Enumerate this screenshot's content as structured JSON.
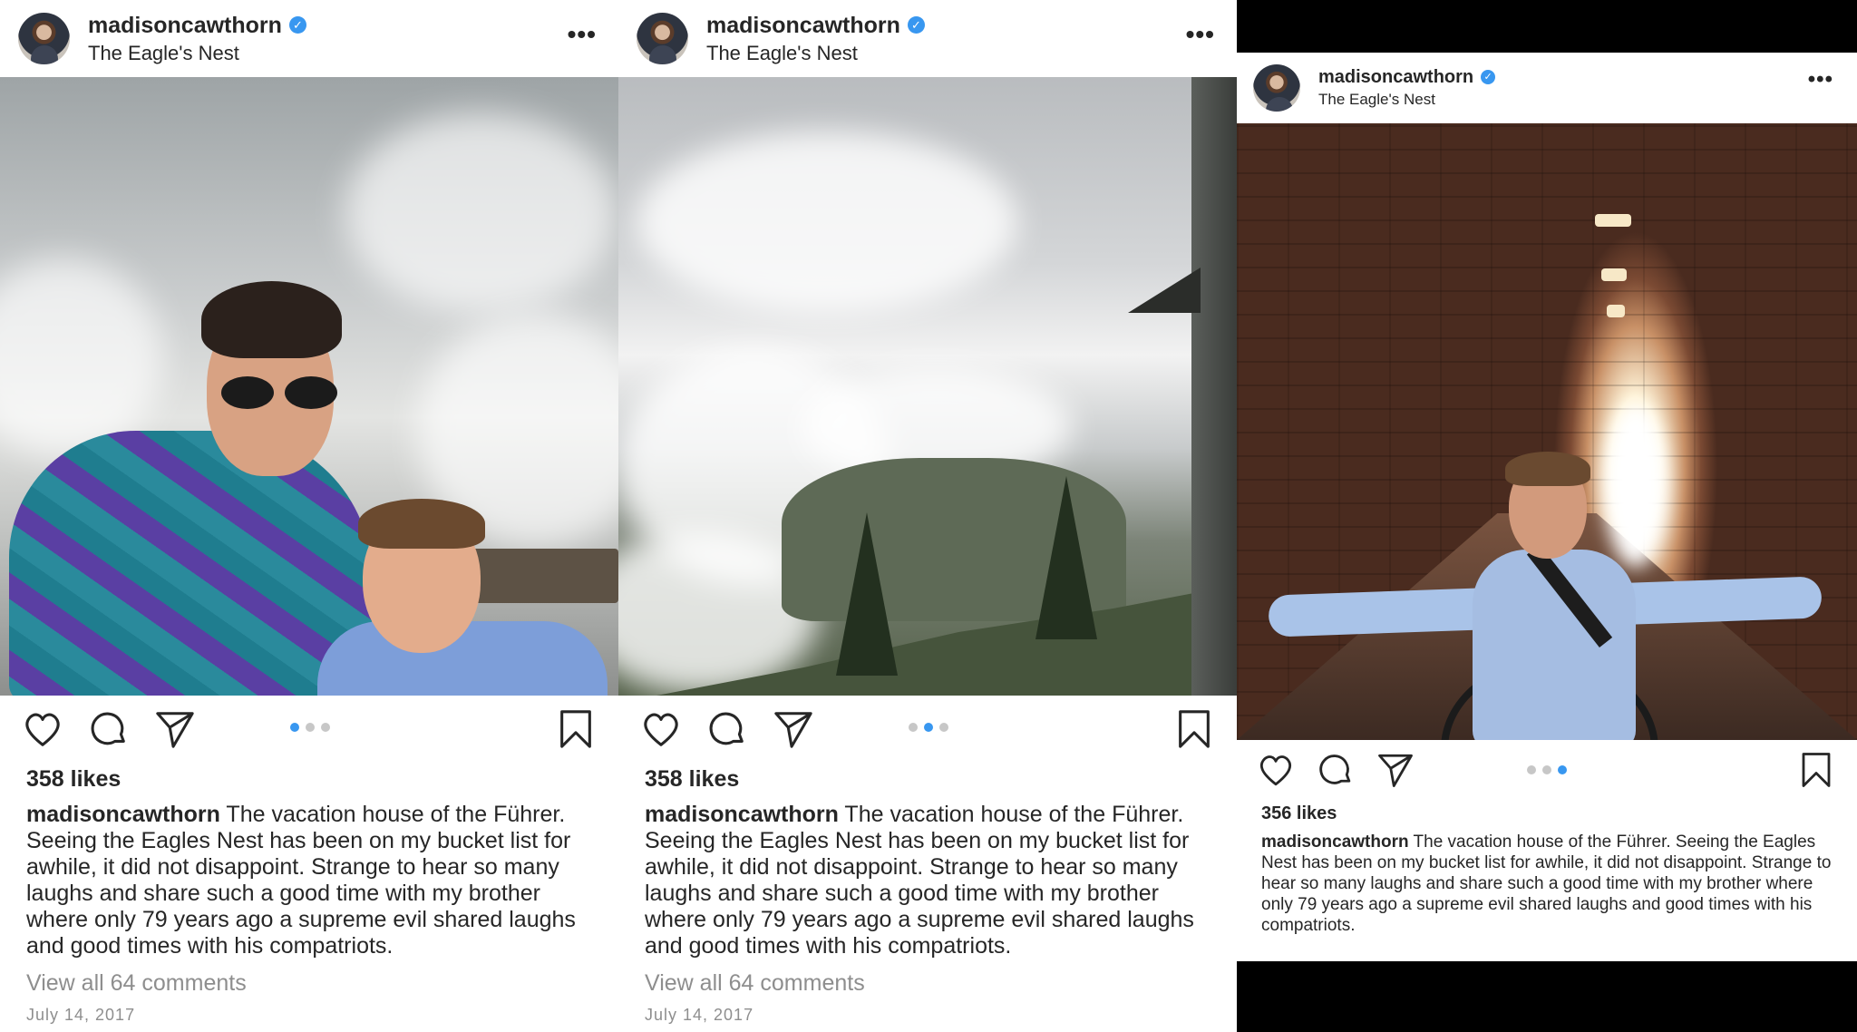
{
  "posts": [
    {
      "username": "madisoncawthorn",
      "location": "The Eagle's Nest",
      "more": "•••",
      "likes": "358 likes",
      "caption_user": "madisoncawthorn",
      "caption_text": "The vacation house of the Führer. Seeing the Eagles Nest has been on my bucket list for awhile, it did not disappoint. Strange to hear so many laughs and share such a good time with my brother where only 79 years ago a supreme evil shared laughs and good times with his compatriots.",
      "comments_link": "View all 64 comments",
      "date": "July 14, 2017",
      "carousel_index": 0
    },
    {
      "username": "madisoncawthorn",
      "location": "The Eagle's Nest",
      "more": "•••",
      "likes": "358 likes",
      "caption_user": "madisoncawthorn",
      "caption_text": "The vacation house of the Führer. Seeing the Eagles Nest has been on my bucket list for awhile, it did not disappoint. Strange to hear so many laughs and share such a good time with my brother where only 79 years ago a supreme evil shared laughs and good times with his compatriots.",
      "comments_link": "View all 64 comments",
      "date": "July 14, 2017",
      "carousel_index": 1
    },
    {
      "username": "madisoncawthorn",
      "location": "The Eagle's Nest",
      "more": "•••",
      "likes": "356 likes",
      "caption_user": "madisoncawthorn",
      "caption_text": "The vacation house of the Führer. Seeing the Eagles Nest has been on my bucket list for awhile, it did not disappoint. Strange to hear so many laughs and share such a good time with my brother where only 79 years ago a supreme evil shared laughs and good times with his compatriots.",
      "carousel_index": 2
    }
  ],
  "verified_mark": "✓",
  "icons": {
    "like": "heart-icon",
    "comment": "comment-bubble-icon",
    "share": "paper-plane-icon",
    "save": "bookmark-icon",
    "verified": "verified-badge-icon",
    "more": "more-options-icon"
  },
  "colors": {
    "verified_blue": "#3897f0",
    "active_dot": "#3897f0",
    "inactive_dot": "#c7c7c7",
    "muted_text": "#8e8e8e"
  }
}
